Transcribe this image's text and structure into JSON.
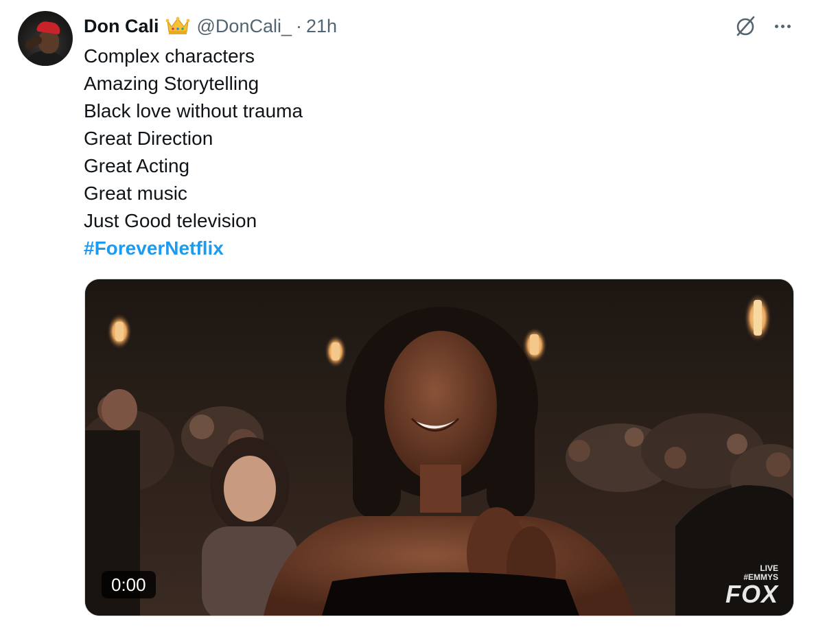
{
  "tweet": {
    "author_name": "Don Cali",
    "handle": "@DonCali_",
    "separator": "·",
    "time": "21h",
    "lines": [
      "Complex characters",
      "Amazing Storytelling",
      "Black love without trauma",
      "Great Direction",
      "Great Acting",
      "Great music",
      "Just Good television"
    ],
    "hashtag": "#ForeverNetflix"
  },
  "video": {
    "timestamp": "0:00",
    "watermark_top": "LIVE",
    "watermark_mid": "#EMMYS",
    "watermark_brand": "FOX"
  },
  "icons": {
    "avatar": "avatar",
    "crown": "crown-emoji-icon",
    "grok": "grok-icon",
    "more": "more-options-icon"
  },
  "colors": {
    "text": "#0f1419",
    "secondary": "#536471",
    "link": "#1d9bf0",
    "border": "#cfd9de"
  }
}
